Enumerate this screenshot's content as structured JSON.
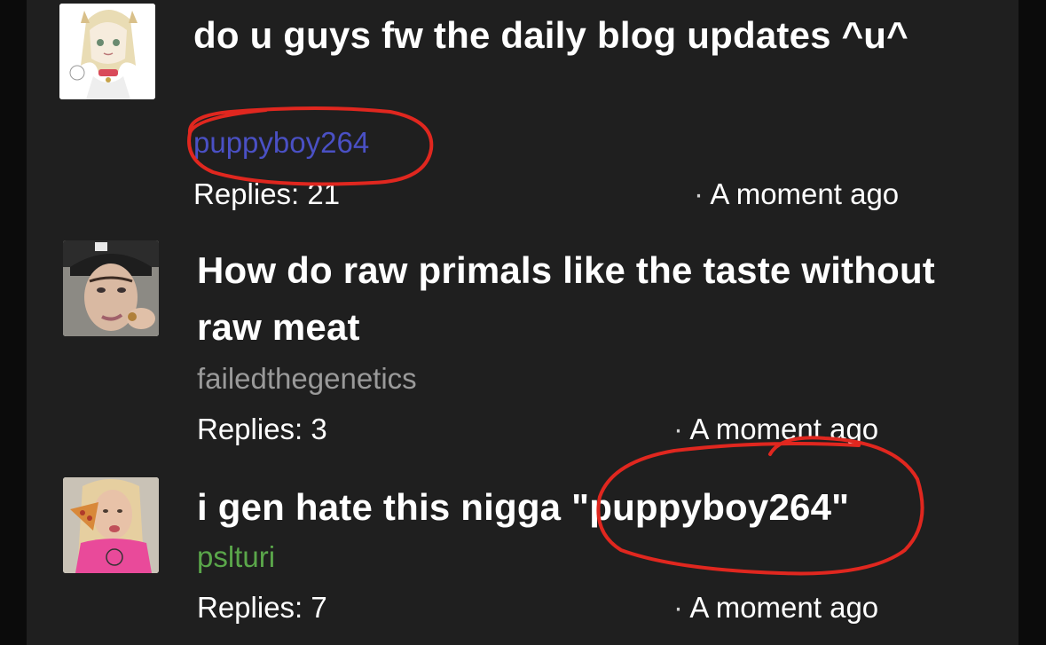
{
  "threads": [
    {
      "title": "do u guys fw the daily blog updates ^u^",
      "author": "puppyboy264",
      "author_color": "#4a50c4",
      "replies": "Replies: 21",
      "time": "A moment ago",
      "avatar": "anime-character-avatar"
    },
    {
      "title": "How do raw primals like the taste without raw meat",
      "author": "failedthegenetics",
      "author_color": "#9a9a9a",
      "replies": "Replies: 3",
      "time": "A moment ago",
      "avatar": "young-man-photo-avatar"
    },
    {
      "title": "i gen hate this nigga \"puppyboy264\"",
      "author": "pslturi",
      "author_color": "#5aa64a",
      "replies": "Replies: 7",
      "time": "A moment ago",
      "avatar": "girl-with-pizza-photo-avatar"
    }
  ],
  "separator": "·",
  "annotation_color": "#e0271f"
}
